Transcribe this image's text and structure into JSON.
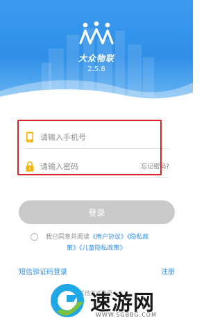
{
  "header": {
    "brand": "大众物联",
    "version": "2.5.8",
    "colors": {
      "sky": "#2f8fe8",
      "wave": "#ffffff"
    }
  },
  "form": {
    "phone_placeholder": "请输入手机号",
    "password_placeholder": "请输入密码",
    "forgot_label": "忘记密码?",
    "icons": {
      "phone": "phone-icon",
      "lock": "lock-icon"
    }
  },
  "login": {
    "label": "登录",
    "color": "#c9c9c9"
  },
  "agreement": {
    "prefix": "我已同意并阅读",
    "user_protocol": "《用户协议》",
    "privacy_part1": "《隐私政",
    "privacy_part2": "策》",
    "child_privacy": "《儿童隐私政策》"
  },
  "footer": {
    "sms_login": "短信验证码登录",
    "register": "注册",
    "other_methods": "其他方式登录"
  },
  "watermark": {
    "text": "速游网",
    "url": "WWW.SGBBG.COM"
  },
  "accent": "#2f8fe8",
  "highlight_color": "#d9242b"
}
